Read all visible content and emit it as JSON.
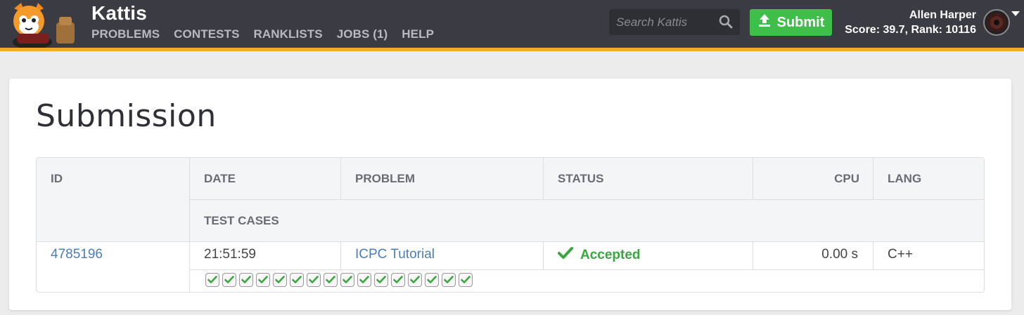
{
  "header": {
    "brand": "Kattis",
    "nav": [
      "PROBLEMS",
      "CONTESTS",
      "RANKLISTS",
      "JOBS (1)",
      "HELP"
    ],
    "search_placeholder": "Search Kattis",
    "submit_label": "Submit",
    "user_name": "Allen Harper",
    "user_stats": "Score: 39.7, Rank: 10116",
    "accent_color": "#f0ad23",
    "submit_color": "#3fbf4a"
  },
  "page": {
    "title": "Submission"
  },
  "table": {
    "headers": {
      "id": "ID",
      "date": "DATE",
      "problem": "PROBLEM",
      "status": "STATUS",
      "cpu": "CPU",
      "lang": "LANG",
      "test_cases": "TEST CASES"
    },
    "row": {
      "id": "4785196",
      "date": "21:51:59",
      "problem": "ICPC Tutorial",
      "status": "Accepted",
      "cpu": "0.00 s",
      "lang": "C++"
    },
    "test_case_count": 16,
    "status_color": "#3aa63f"
  }
}
